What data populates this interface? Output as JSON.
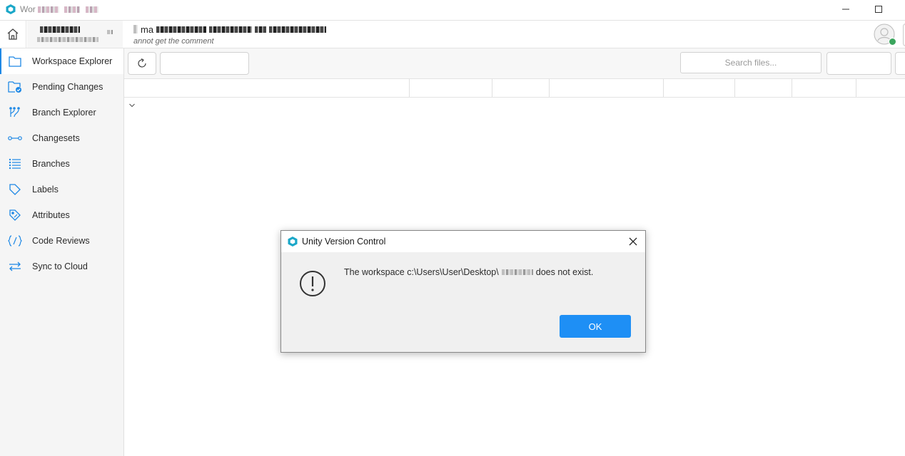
{
  "window": {
    "title": "Wor"
  },
  "header": {
    "changeset_prefix": "ma",
    "comment": "annot get the comment"
  },
  "sidebar": {
    "items": [
      {
        "label": "Workspace Explorer",
        "icon": "folder-icon",
        "active": true
      },
      {
        "label": "Pending Changes",
        "icon": "pending-changes-icon",
        "active": false
      },
      {
        "label": "Branch Explorer",
        "icon": "branch-explorer-icon",
        "active": false
      },
      {
        "label": "Changesets",
        "icon": "changesets-icon",
        "active": false
      },
      {
        "label": "Branches",
        "icon": "branches-list-icon",
        "active": false
      },
      {
        "label": "Labels",
        "icon": "label-tag-icon",
        "active": false
      },
      {
        "label": "Attributes",
        "icon": "attributes-tag-icon",
        "active": false
      },
      {
        "label": "Code Reviews",
        "icon": "code-reviews-icon",
        "active": false
      },
      {
        "label": "Sync to Cloud",
        "icon": "sync-arrows-icon",
        "active": false
      }
    ]
  },
  "toolbar": {
    "search_placeholder": "Search files..."
  },
  "dialog": {
    "title": "Unity Version Control",
    "message_before": "The workspace c:\\Users\\User\\Desktop\\",
    "message_after": "does not exist.",
    "ok_label": "OK"
  },
  "colors": {
    "accent": "#1e88e5",
    "ok_button": "#1e8ff5",
    "logo": "#1aa7c8",
    "status_online": "#3aa55d"
  }
}
